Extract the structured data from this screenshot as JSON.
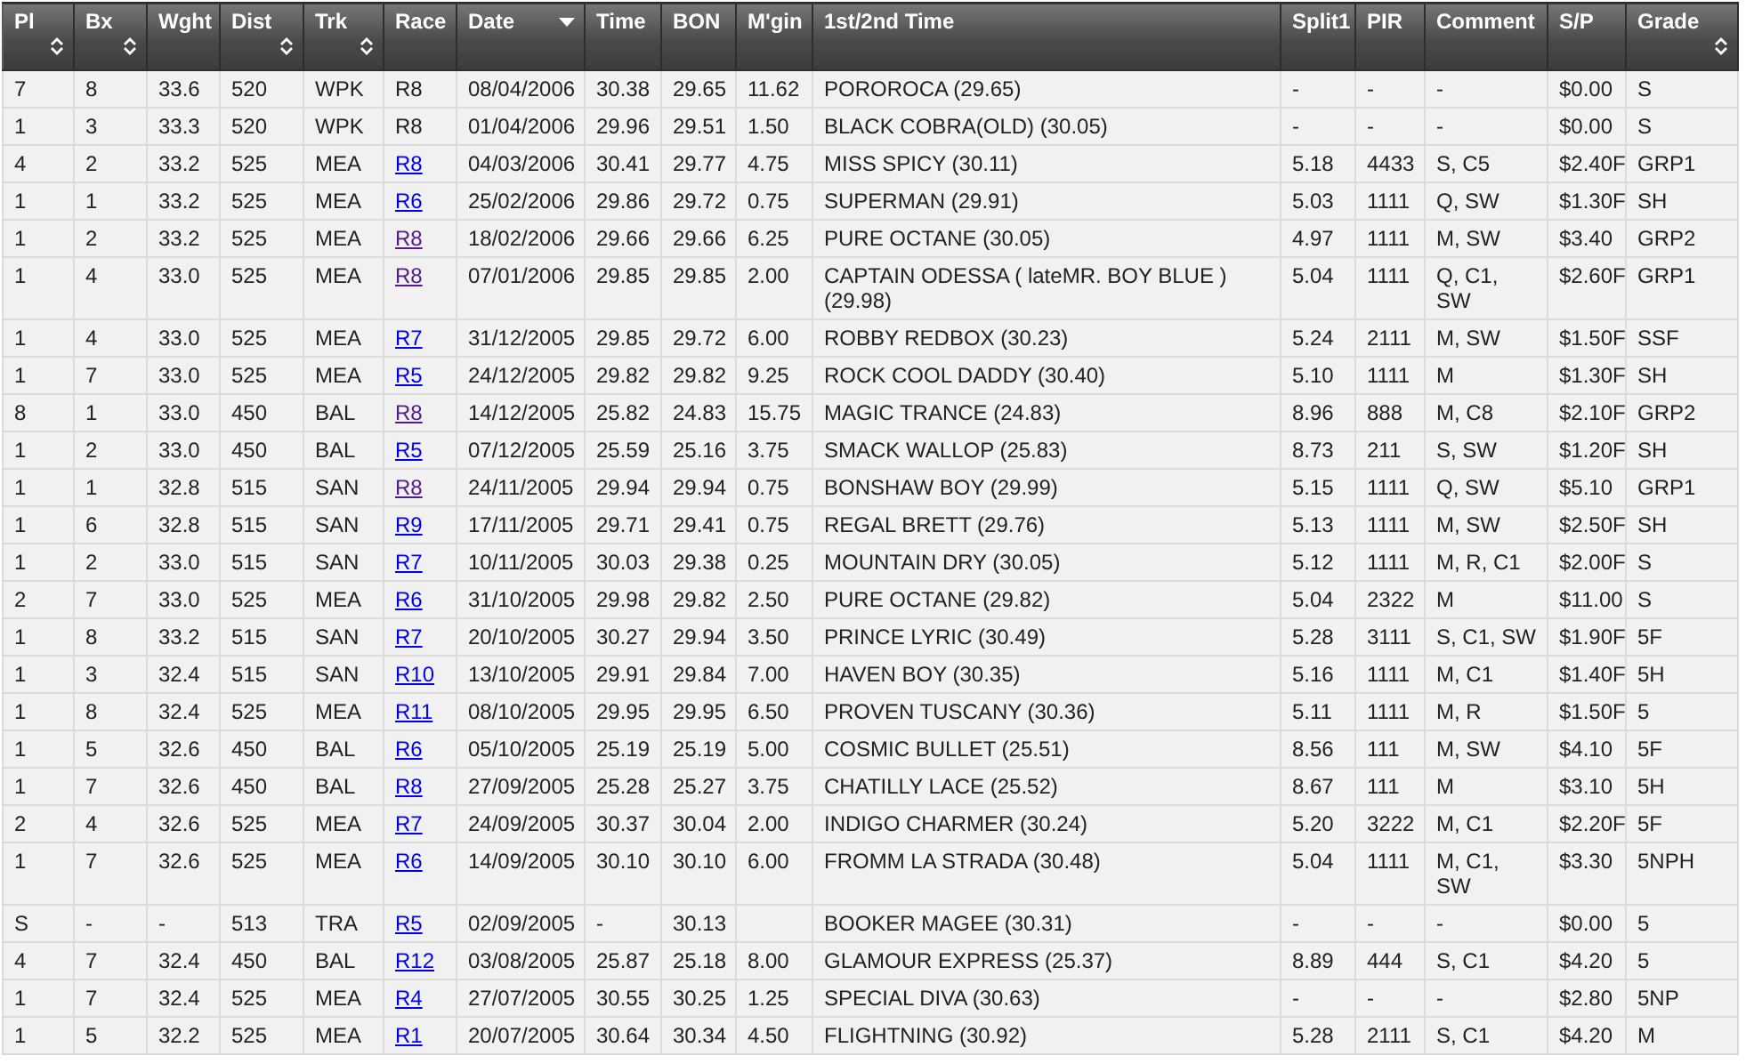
{
  "table": {
    "columns": [
      {
        "label": "Pl",
        "sortable": true,
        "sorted": false
      },
      {
        "label": "Bx",
        "sortable": true,
        "sorted": false
      },
      {
        "label": "Wght",
        "sortable": false,
        "sorted": false
      },
      {
        "label": "Dist",
        "sortable": true,
        "sorted": false
      },
      {
        "label": "Trk",
        "sortable": true,
        "sorted": false
      },
      {
        "label": "Race",
        "sortable": false,
        "sorted": false
      },
      {
        "label": "Date",
        "sortable": false,
        "sorted": true
      },
      {
        "label": "Time",
        "sortable": false,
        "sorted": false
      },
      {
        "label": "BON",
        "sortable": false,
        "sorted": false
      },
      {
        "label": "M'gin",
        "sortable": false,
        "sorted": false
      },
      {
        "label": "1st/2nd Time",
        "sortable": false,
        "sorted": false
      },
      {
        "label": "Split1",
        "sortable": false,
        "sorted": false
      },
      {
        "label": "PIR",
        "sortable": false,
        "sorted": false
      },
      {
        "label": "Comment",
        "sortable": false,
        "sorted": false
      },
      {
        "label": "S/P",
        "sortable": false,
        "sorted": false
      },
      {
        "label": "Grade",
        "sortable": true,
        "sorted": false
      }
    ],
    "rows": [
      {
        "race_link": false,
        "cells": [
          "7",
          "8",
          "33.6",
          "520",
          "WPK",
          "R8",
          "08/04/2006",
          "30.38",
          "29.65",
          "11.62",
          "POROROCA (29.65)",
          "-",
          "-",
          "-",
          "$0.00",
          "S"
        ]
      },
      {
        "race_link": false,
        "cells": [
          "1",
          "3",
          "33.3",
          "520",
          "WPK",
          "R8",
          "01/04/2006",
          "29.96",
          "29.51",
          "1.50",
          "BLACK COBRA(OLD) (30.05)",
          "-",
          "-",
          "-",
          "$0.00",
          "S"
        ]
      },
      {
        "race_link": true,
        "visited": false,
        "cells": [
          "4",
          "2",
          "33.2",
          "525",
          "MEA",
          "R8",
          "04/03/2006",
          "30.41",
          "29.77",
          "4.75",
          "MISS SPICY (30.11)",
          "5.18",
          "4433",
          "S, C5",
          "$2.40F",
          "GRP1"
        ]
      },
      {
        "race_link": true,
        "visited": false,
        "cells": [
          "1",
          "1",
          "33.2",
          "525",
          "MEA",
          "R6",
          "25/02/2006",
          "29.86",
          "29.72",
          "0.75",
          "SUPERMAN (29.91)",
          "5.03",
          "1111",
          "Q, SW",
          "$1.30F",
          "SH"
        ]
      },
      {
        "race_link": true,
        "visited": true,
        "cells": [
          "1",
          "2",
          "33.2",
          "525",
          "MEA",
          "R8",
          "18/02/2006",
          "29.66",
          "29.66",
          "6.25",
          "PURE OCTANE (30.05)",
          "4.97",
          "1111",
          "M, SW",
          "$3.40",
          "GRP2"
        ]
      },
      {
        "race_link": true,
        "visited": true,
        "cells": [
          "1",
          "4",
          "33.0",
          "525",
          "MEA",
          "R8",
          "07/01/2006",
          "29.85",
          "29.85",
          "2.00",
          "CAPTAIN ODESSA ( lateMR. BOY BLUE ) (29.98)",
          "5.04",
          "1111",
          "Q, C1, SW",
          "$2.60F",
          "GRP1"
        ]
      },
      {
        "race_link": true,
        "visited": false,
        "cells": [
          "1",
          "4",
          "33.0",
          "525",
          "MEA",
          "R7",
          "31/12/2005",
          "29.85",
          "29.72",
          "6.00",
          "ROBBY REDBOX (30.23)",
          "5.24",
          "2111",
          "M, SW",
          "$1.50F",
          "SSF"
        ]
      },
      {
        "race_link": true,
        "visited": false,
        "cells": [
          "1",
          "7",
          "33.0",
          "525",
          "MEA",
          "R5",
          "24/12/2005",
          "29.82",
          "29.82",
          "9.25",
          "ROCK COOL DADDY (30.40)",
          "5.10",
          "1111",
          "M",
          "$1.30F",
          "SH"
        ]
      },
      {
        "race_link": true,
        "visited": true,
        "cells": [
          "8",
          "1",
          "33.0",
          "450",
          "BAL",
          "R8",
          "14/12/2005",
          "25.82",
          "24.83",
          "15.75",
          "MAGIC TRANCE (24.83)",
          "8.96",
          "888",
          "M, C8",
          "$2.10F",
          "GRP2"
        ]
      },
      {
        "race_link": true,
        "visited": false,
        "cells": [
          "1",
          "2",
          "33.0",
          "450",
          "BAL",
          "R5",
          "07/12/2005",
          "25.59",
          "25.16",
          "3.75",
          "SMACK WALLOP (25.83)",
          "8.73",
          "211",
          "S, SW",
          "$1.20F",
          "SH"
        ]
      },
      {
        "race_link": true,
        "visited": true,
        "cells": [
          "1",
          "1",
          "32.8",
          "515",
          "SAN",
          "R8",
          "24/11/2005",
          "29.94",
          "29.94",
          "0.75",
          "BONSHAW BOY (29.99)",
          "5.15",
          "1111",
          "Q, SW",
          "$5.10",
          "GRP1"
        ]
      },
      {
        "race_link": true,
        "visited": false,
        "cells": [
          "1",
          "6",
          "32.8",
          "515",
          "SAN",
          "R9",
          "17/11/2005",
          "29.71",
          "29.41",
          "0.75",
          "REGAL BRETT (29.76)",
          "5.13",
          "1111",
          "M, SW",
          "$2.50F",
          "SH"
        ]
      },
      {
        "race_link": true,
        "visited": false,
        "cells": [
          "1",
          "2",
          "33.0",
          "515",
          "SAN",
          "R7",
          "10/11/2005",
          "30.03",
          "29.38",
          "0.25",
          "MOUNTAIN DRY (30.05)",
          "5.12",
          "1111",
          "M, R, C1",
          "$2.00F",
          "S"
        ]
      },
      {
        "race_link": true,
        "visited": false,
        "cells": [
          "2",
          "7",
          "33.0",
          "525",
          "MEA",
          "R6",
          "31/10/2005",
          "29.98",
          "29.82",
          "2.50",
          "PURE OCTANE (29.82)",
          "5.04",
          "2322",
          "M",
          "$11.00",
          "S"
        ]
      },
      {
        "race_link": true,
        "visited": false,
        "cells": [
          "1",
          "8",
          "33.2",
          "515",
          "SAN",
          "R7",
          "20/10/2005",
          "30.27",
          "29.94",
          "3.50",
          "PRINCE LYRIC (30.49)",
          "5.28",
          "3111",
          "S, C1, SW",
          "$1.90F",
          "5F"
        ]
      },
      {
        "race_link": true,
        "visited": false,
        "cells": [
          "1",
          "3",
          "32.4",
          "515",
          "SAN",
          "R10",
          "13/10/2005",
          "29.91",
          "29.84",
          "7.00",
          "HAVEN BOY (30.35)",
          "5.16",
          "1111",
          "M, C1",
          "$1.40F",
          "5H"
        ]
      },
      {
        "race_link": true,
        "visited": false,
        "cells": [
          "1",
          "8",
          "32.4",
          "525",
          "MEA",
          "R11",
          "08/10/2005",
          "29.95",
          "29.95",
          "6.50",
          "PROVEN TUSCANY (30.36)",
          "5.11",
          "1111",
          "M, R",
          "$1.50F",
          "5"
        ]
      },
      {
        "race_link": true,
        "visited": false,
        "cells": [
          "1",
          "5",
          "32.6",
          "450",
          "BAL",
          "R6",
          "05/10/2005",
          "25.19",
          "25.19",
          "5.00",
          "COSMIC BULLET (25.51)",
          "8.56",
          "111",
          "M, SW",
          "$4.10",
          "5F"
        ]
      },
      {
        "race_link": true,
        "visited": false,
        "cells": [
          "1",
          "7",
          "32.6",
          "450",
          "BAL",
          "R8",
          "27/09/2005",
          "25.28",
          "25.27",
          "3.75",
          "CHATILLY LACE (25.52)",
          "8.67",
          "111",
          "M",
          "$3.10",
          "5H"
        ]
      },
      {
        "race_link": true,
        "visited": false,
        "cells": [
          "2",
          "4",
          "32.6",
          "525",
          "MEA",
          "R7",
          "24/09/2005",
          "30.37",
          "30.04",
          "2.00",
          "INDIGO CHARMER (30.24)",
          "5.20",
          "3222",
          "M, C1",
          "$2.20F",
          "5F"
        ]
      },
      {
        "race_link": true,
        "visited": false,
        "cells": [
          "1",
          "7",
          "32.6",
          "525",
          "MEA",
          "R6",
          "14/09/2005",
          "30.10",
          "30.10",
          "6.00",
          "FROMM LA STRADA (30.48)",
          "5.04",
          "1111",
          "M, C1, SW",
          "$3.30",
          "5NPH"
        ]
      },
      {
        "race_link": true,
        "visited": false,
        "cells": [
          "S",
          "-",
          "-",
          "513",
          "TRA",
          "R5",
          "02/09/2005",
          "-",
          "30.13",
          null,
          "BOOKER MAGEE (30.31)",
          "-",
          "-",
          "-",
          "$0.00",
          "5"
        ]
      },
      {
        "race_link": true,
        "visited": false,
        "cells": [
          "4",
          "7",
          "32.4",
          "450",
          "BAL",
          "R12",
          "03/08/2005",
          "25.87",
          "25.18",
          "8.00",
          "GLAMOUR EXPRESS (25.37)",
          "8.89",
          "444",
          "S, C1",
          "$4.20",
          "5"
        ]
      },
      {
        "race_link": true,
        "visited": false,
        "cells": [
          "1",
          "7",
          "32.4",
          "525",
          "MEA",
          "R4",
          "27/07/2005",
          "30.55",
          "30.25",
          "1.25",
          "SPECIAL DIVA (30.63)",
          "-",
          "-",
          "-",
          "$2.80",
          "5NP"
        ]
      },
      {
        "race_link": true,
        "visited": false,
        "cells": [
          "1",
          "5",
          "32.2",
          "525",
          "MEA",
          "R1",
          "20/07/2005",
          "30.64",
          "30.34",
          "4.50",
          "FLIGHTNING (30.92)",
          "5.28",
          "2111",
          "S, C1",
          "$4.20",
          "M"
        ]
      }
    ]
  }
}
